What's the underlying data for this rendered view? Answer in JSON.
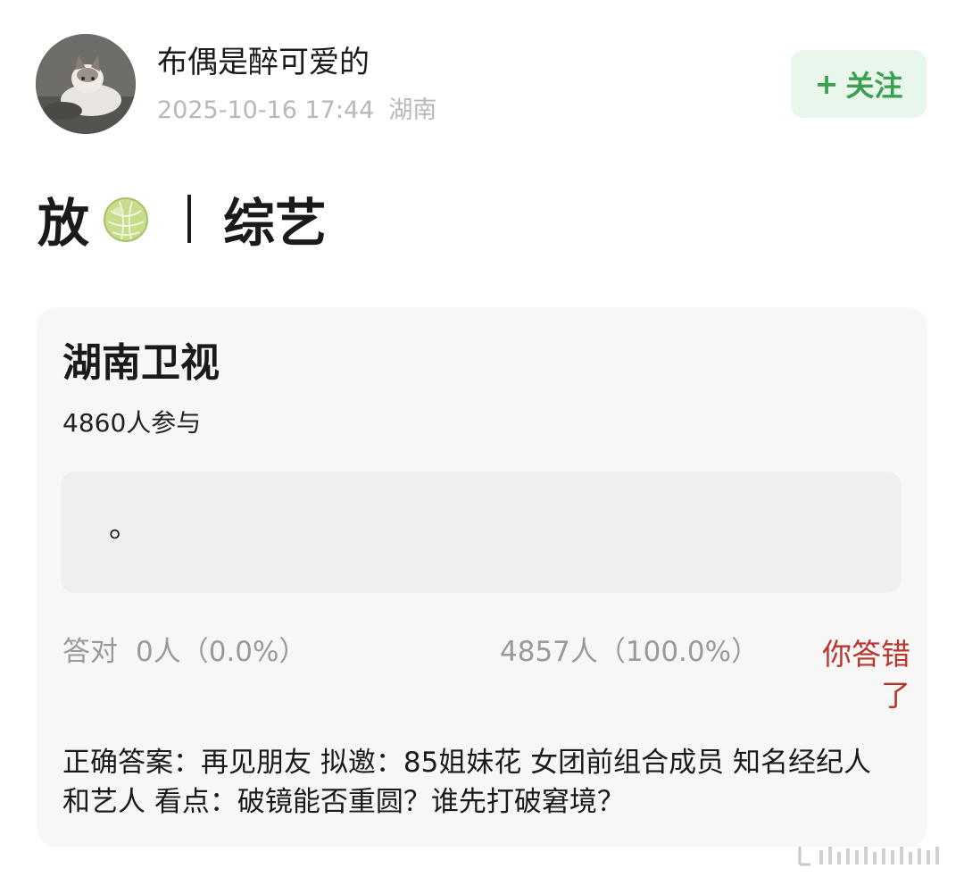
{
  "post": {
    "username": "布偶是醉可爱的",
    "timestamp": "2025-10-16 17:44",
    "location": "湖南",
    "follow_plus": "+",
    "follow_label": "关注",
    "title_prefix": "放",
    "title_suffix": "综艺"
  },
  "quiz": {
    "title": "湖南卫视",
    "participants": "4860人参与",
    "option_text": "。",
    "correct_label": "答对",
    "correct_count": "0人（0.0%）",
    "other_count": "4857人（100.0%）",
    "result_label": "你答错了",
    "answer_text": "正确答案：再见朋友 拟邀：85姐妹花 女团前组合成员 知名经纪人和艺人 看点：破镜能否重圆？谁先打破窘境？"
  },
  "colors": {
    "follow_bg": "#e9f6ec",
    "follow_text": "#3aa050",
    "wrong_text": "#b8362e",
    "card_bg": "#f7f7f7",
    "muted_text": "#9a9a9a"
  },
  "icons": {
    "avatar": "cat-avatar",
    "title_emoji": "melon-icon"
  }
}
